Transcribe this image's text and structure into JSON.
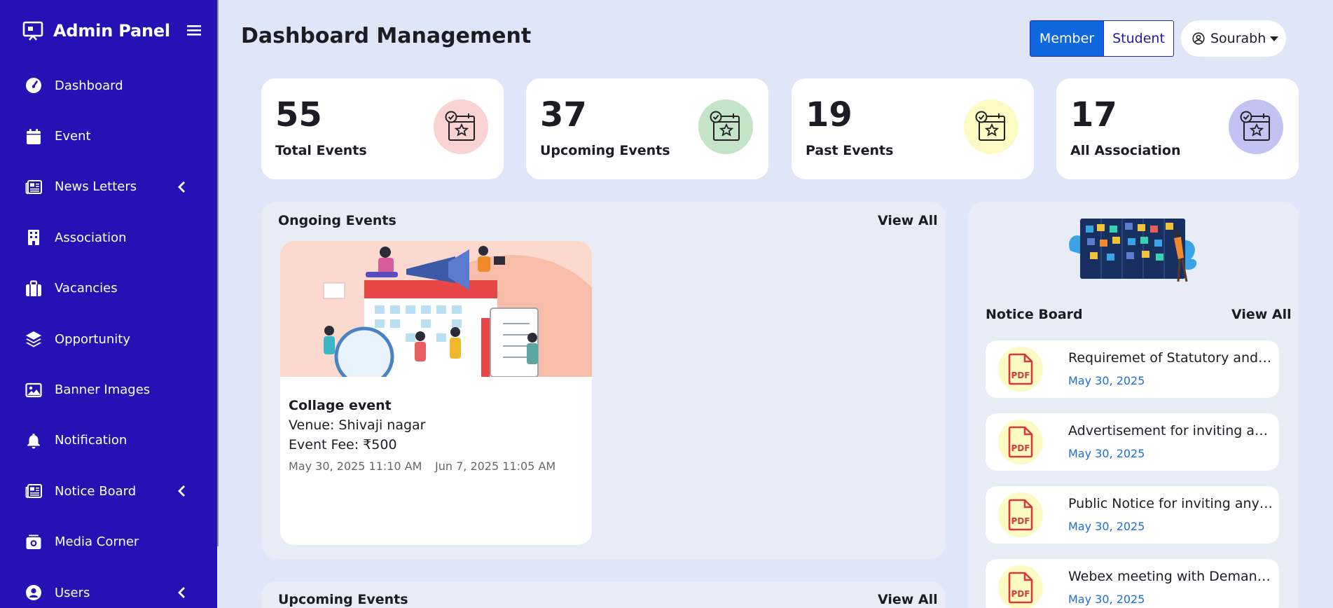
{
  "app": {
    "title": "Admin Panel"
  },
  "sidebar": {
    "items": [
      {
        "label": "Dashboard",
        "icon": "gauge-icon",
        "has_submenu": false
      },
      {
        "label": "Event",
        "icon": "calendar-icon",
        "has_submenu": false
      },
      {
        "label": "News Letters",
        "icon": "newspaper-icon",
        "has_submenu": true
      },
      {
        "label": "Association",
        "icon": "building-icon",
        "has_submenu": false
      },
      {
        "label": "Vacancies",
        "icon": "briefcase-icon",
        "has_submenu": false
      },
      {
        "label": "Opportunity",
        "icon": "layers-icon",
        "has_submenu": false
      },
      {
        "label": "Banner Images",
        "icon": "image-icon",
        "has_submenu": false
      },
      {
        "label": "Notification",
        "icon": "bell-icon",
        "has_submenu": false
      },
      {
        "label": "Notice Board",
        "icon": "newspaper-icon",
        "has_submenu": true
      },
      {
        "label": "Media Corner",
        "icon": "camera-icon",
        "has_submenu": false
      },
      {
        "label": "Users",
        "icon": "user-circle-icon",
        "has_submenu": true
      }
    ]
  },
  "header": {
    "title": "Dashboard Management",
    "toggle": {
      "member": "Member",
      "student": "Student",
      "selected": "Member"
    },
    "user": "Sourabh"
  },
  "stats": [
    {
      "value": "55",
      "label": "Total Events",
      "color": "#f9d2d2"
    },
    {
      "value": "37",
      "label": "Upcoming Events",
      "color": "#c5e3c6"
    },
    {
      "value": "19",
      "label": "Past Events",
      "color": "#fdfbc3"
    },
    {
      "value": "17",
      "label": "All Association",
      "color": "#c2c2f3"
    }
  ],
  "ongoing": {
    "heading": "Ongoing Events",
    "view_all": "View All",
    "event": {
      "title": "Collage event",
      "venue": "Venue: Shivaji nagar",
      "fee": "Event Fee: ₹500",
      "start": "May 30, 2025 11:10 AM",
      "end": "Jun 7, 2025 11:05 AM"
    }
  },
  "upcoming": {
    "heading": "Upcoming Events",
    "view_all": "View All"
  },
  "notice_board": {
    "heading": "Notice Board",
    "view_all": "View All",
    "items": [
      {
        "title": "Requiremet of Statutory and Internal Auditors",
        "date": "May 30, 2025"
      },
      {
        "title": "Advertisement for inviting applications",
        "date": "May 30, 2025"
      },
      {
        "title": "Public Notice for inviting any comments",
        "date": "May 30, 2025"
      },
      {
        "title": "Webex meeting with Demand Notice",
        "date": "May 30, 2025"
      }
    ]
  },
  "colors": {
    "sidebar": "#2412b5",
    "accent": "#0e67de",
    "page_bg": "#dfe6f7",
    "pdf_red": "#d63a3a"
  }
}
